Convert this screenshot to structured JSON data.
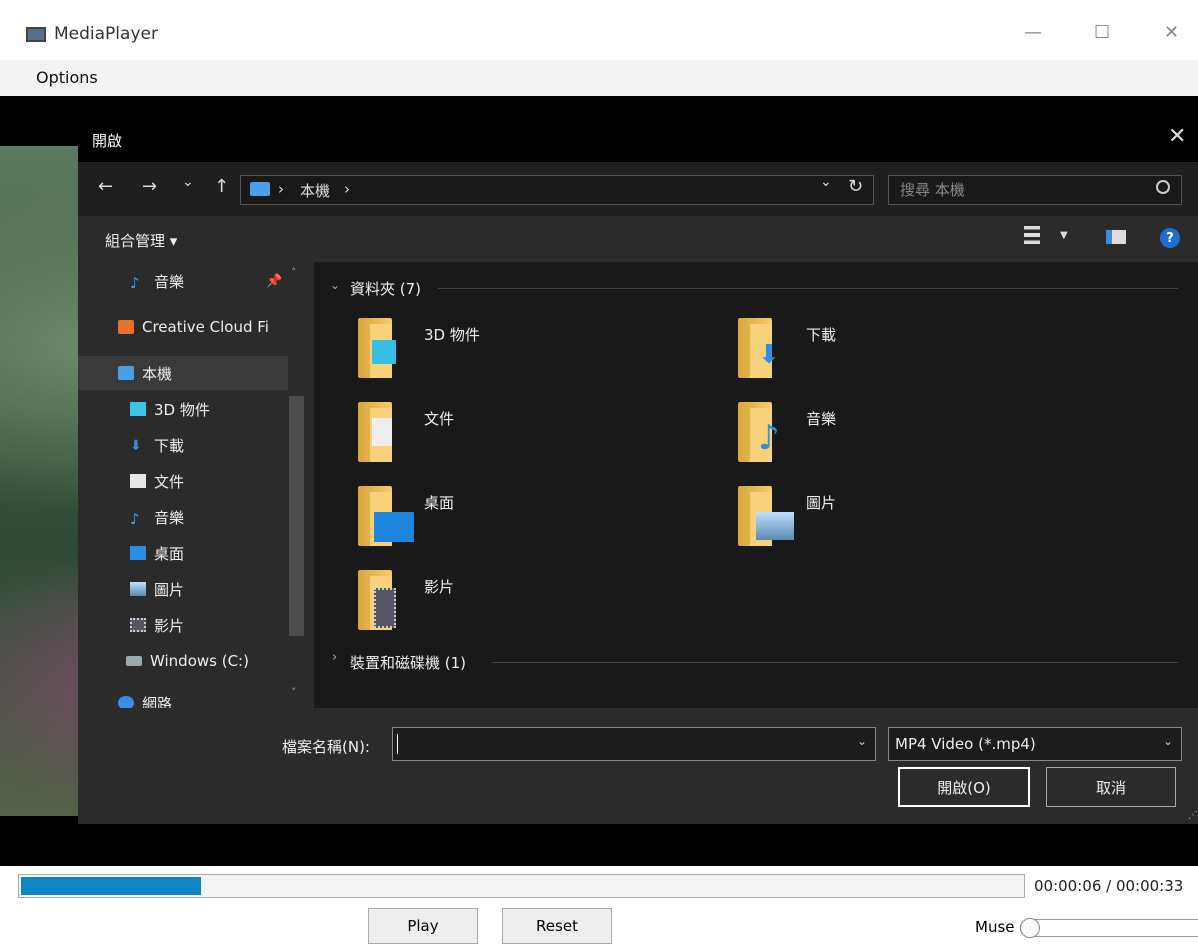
{
  "window": {
    "title": "MediaPlayer",
    "minimize": "—",
    "maximize": "☐",
    "close": "✕"
  },
  "menu": {
    "options": "Options"
  },
  "dialog": {
    "title": "開啟",
    "close": "✕",
    "nav": {
      "back": "←",
      "forward": "→",
      "recent": "⌄",
      "up": "↑",
      "refresh": "↻",
      "dropdown": "⌄"
    },
    "address": {
      "path": "本機",
      "sep1": "›",
      "sep2": "›"
    },
    "search": {
      "placeholder": "搜尋 本機"
    },
    "toolbar": {
      "organize": "組合管理 ▾",
      "help": "?"
    },
    "nav_pane": [
      {
        "label": "音樂",
        "icon": "music-icon"
      },
      {
        "label": "Creative Cloud Fi",
        "icon": "creative-cloud-icon"
      },
      {
        "label": "本機",
        "icon": "this-pc-icon"
      },
      {
        "label": "3D 物件",
        "icon": "3d-objects-icon"
      },
      {
        "label": "下載",
        "icon": "download-icon"
      },
      {
        "label": "文件",
        "icon": "document-icon"
      },
      {
        "label": "音樂",
        "icon": "music-icon"
      },
      {
        "label": "桌面",
        "icon": "desktop-icon"
      },
      {
        "label": "圖片",
        "icon": "pictures-icon"
      },
      {
        "label": "影片",
        "icon": "videos-icon"
      },
      {
        "label": "Windows (C:)",
        "icon": "drive-icon"
      },
      {
        "label": "網路",
        "icon": "network-icon"
      }
    ],
    "folders_header": "資料夾 (7)",
    "folders": [
      {
        "label": "3D 物件",
        "icon": "3d-objects-folder-icon"
      },
      {
        "label": "下載",
        "icon": "downloads-folder-icon"
      },
      {
        "label": "文件",
        "icon": "documents-folder-icon"
      },
      {
        "label": "音樂",
        "icon": "music-folder-icon"
      },
      {
        "label": "桌面",
        "icon": "desktop-folder-icon"
      },
      {
        "label": "圖片",
        "icon": "pictures-folder-icon"
      },
      {
        "label": "影片",
        "icon": "videos-folder-icon"
      }
    ],
    "devices_header": "裝置和磁碟機 (1)",
    "filename_label": "檔案名稱(N):",
    "filename_value": "",
    "file_type": "MP4 Video (*.mp4)",
    "open_button": "開啟(O)",
    "cancel_button": "取消"
  },
  "player": {
    "progress": 0.18,
    "time": "00:00:06 / 00:00:33",
    "play": "Play",
    "reset": "Reset",
    "muse": "Muse"
  },
  "colors": {
    "accent": "#0f85c4",
    "dialog_bg": "#2b2b2b"
  }
}
